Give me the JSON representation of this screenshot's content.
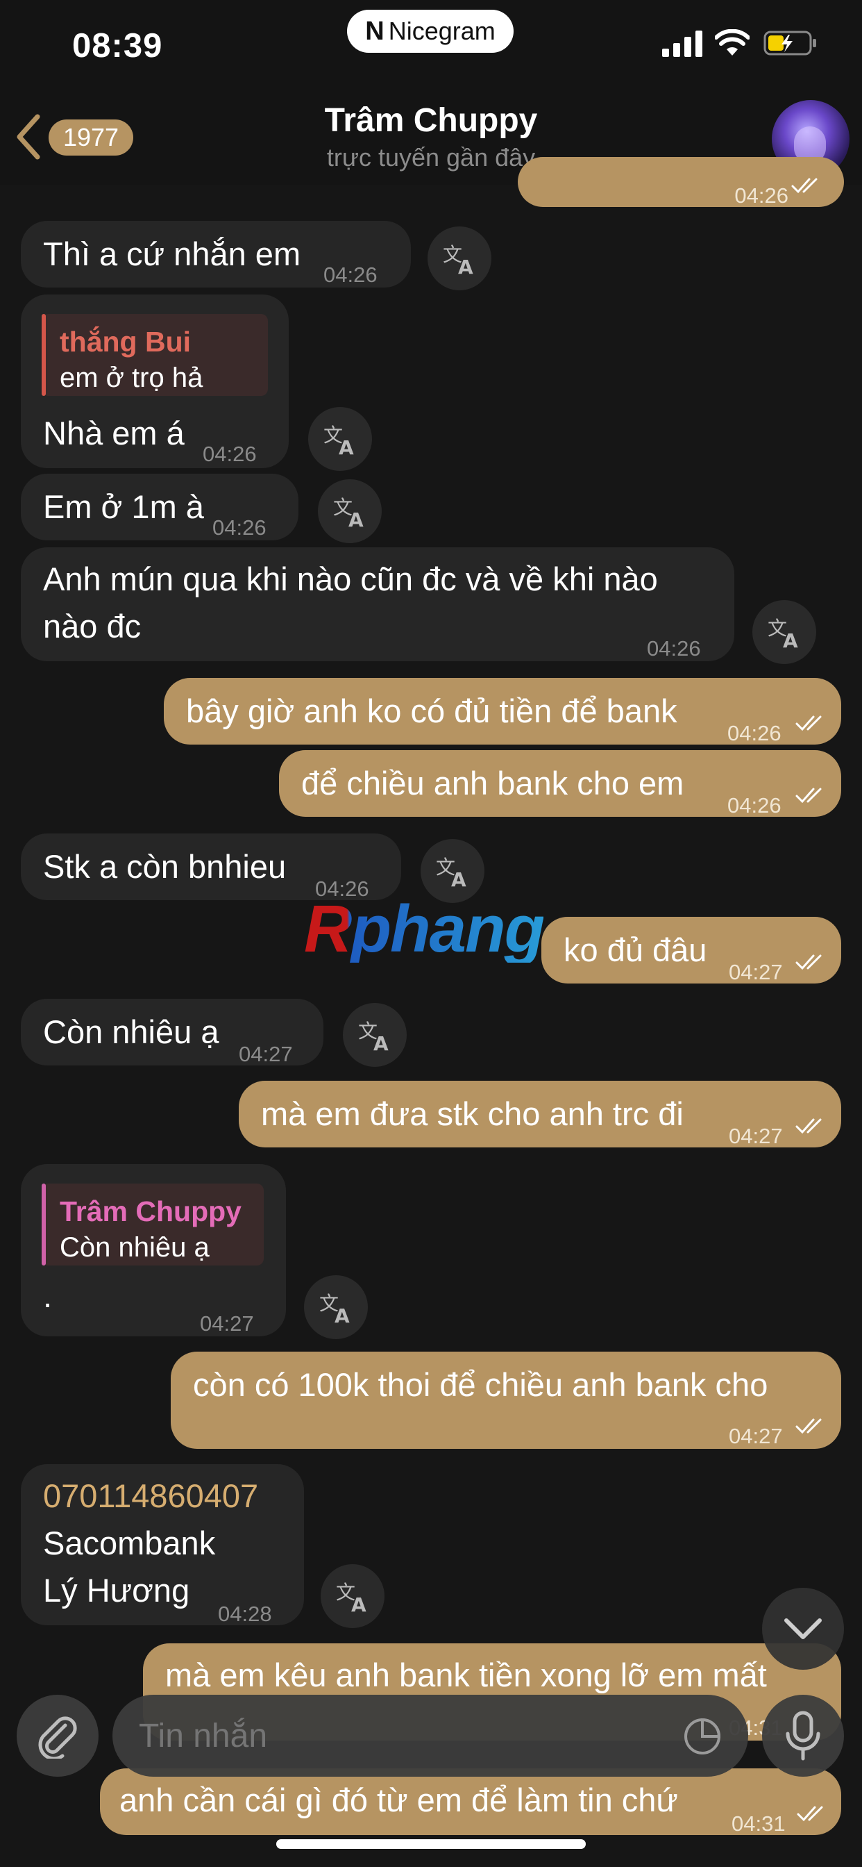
{
  "status": {
    "time": "08:39",
    "pill_label": "Nicegram"
  },
  "header": {
    "back_badge": "1977",
    "title": "Trâm Chuppy",
    "subtitle": "trực tuyến gần đây"
  },
  "messages": [
    {
      "kind": "out",
      "text": "",
      "time": "04:26"
    },
    {
      "kind": "in",
      "text": "Thì a cứ nhắn em",
      "time": "04:26"
    },
    {
      "kind": "in",
      "reply_name": "thắng Bui",
      "reply_text": "em ở trọ hả",
      "text": "Nhà em á",
      "time": "04:26"
    },
    {
      "kind": "in",
      "text": "Em ở 1m à",
      "time": "04:26"
    },
    {
      "kind": "in",
      "text": "Anh mún qua khi nào cũn đc và về khi nào\nnào đc",
      "time": "04:26"
    },
    {
      "kind": "out",
      "text": "bây giờ anh ko có đủ tiền để bank",
      "time": "04:26"
    },
    {
      "kind": "out",
      "text": "để chiều anh bank cho em",
      "time": "04:26"
    },
    {
      "kind": "in",
      "text": "Stk a còn bnhieu",
      "time": "04:26"
    },
    {
      "kind": "out",
      "text": "ko đủ đâu",
      "time": "04:27"
    },
    {
      "kind": "in",
      "text": "Còn nhiêu ạ",
      "time": "04:27"
    },
    {
      "kind": "out",
      "text": "mà em đưa stk cho anh trc đi",
      "time": "04:27"
    },
    {
      "kind": "in",
      "reply_name": "Trâm Chuppy",
      "reply_text": "Còn nhiêu ạ",
      "text": ".",
      "time": "04:27"
    },
    {
      "kind": "out",
      "text": "còn có 100k thoi để chiều anh bank cho",
      "time": "04:27"
    },
    {
      "kind": "in",
      "account_number": "070114860407",
      "text": "Sacombank\nLý Hương",
      "time": "04:28"
    },
    {
      "kind": "out",
      "text": "mà em kêu anh bank tiền xong lỡ em mất",
      "time": "04:31"
    },
    {
      "kind": "out",
      "text": "anh cần cái gì đó từ em để làm tin chứ",
      "time": "04:31"
    }
  ],
  "watermark": "Rphang",
  "composer": {
    "placeholder": "Tin nhắn"
  },
  "colors": {
    "background": "#161616",
    "incoming_bubble": "#262626",
    "outgoing_bubble": "#b69462",
    "accent": "#b69462"
  },
  "icons": [
    "chevron-left-icon",
    "translate-icon",
    "double-check-icon",
    "chevron-down-icon",
    "paperclip-icon",
    "sticker-icon",
    "microphone-icon",
    "signal-icon",
    "wifi-icon",
    "battery-icon"
  ]
}
